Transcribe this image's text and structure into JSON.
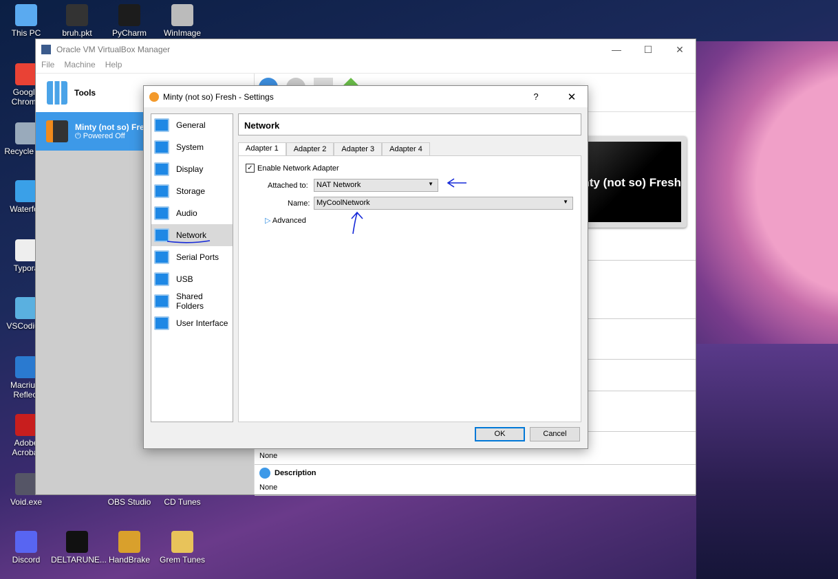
{
  "desktop": {
    "icons": [
      "This PC",
      "bruh.pkt",
      "PyCharm",
      "WinImage",
      "Google Chrome",
      "Recycle Bin",
      "Waterfox",
      "Typora",
      "VSCodium",
      "Macrium Reflect",
      "Adobe Acrobat",
      "Void.exe",
      "OBS Studio",
      "CD Tunes",
      "Discord",
      "DELTARUNE...",
      "HandBrake",
      "Grem Tunes"
    ]
  },
  "manager": {
    "title": "Oracle VM VirtualBox Manager",
    "menu": [
      "File",
      "Machine",
      "Help"
    ],
    "tools_label": "Tools",
    "vm_name": "Minty (not so) Fresh",
    "vm_state": "Powered Off",
    "preview_text": "Minty (not so) Fresh",
    "details": {
      "none1": "None",
      "description_title": "Description",
      "none2": "None"
    }
  },
  "dialog": {
    "title": "Minty (not so) Fresh - Settings",
    "help": "?",
    "close": "✕",
    "sidebar": [
      {
        "label": "General"
      },
      {
        "label": "System"
      },
      {
        "label": "Display"
      },
      {
        "label": "Storage"
      },
      {
        "label": "Audio"
      },
      {
        "label": "Network",
        "selected": true
      },
      {
        "label": "Serial Ports"
      },
      {
        "label": "USB"
      },
      {
        "label": "Shared Folders"
      },
      {
        "label": "User Interface"
      }
    ],
    "section_title": "Network",
    "tabs": [
      "Adapter 1",
      "Adapter 2",
      "Adapter 3",
      "Adapter 4"
    ],
    "active_tab": "Adapter 1",
    "enable_label": "Enable Network Adapter",
    "enable_checked": true,
    "attached_label": "Attached to:",
    "attached_value": "NAT Network",
    "name_label": "Name:",
    "name_value": "MyCoolNetwork",
    "advanced_label": "Advanced",
    "ok": "OK",
    "cancel": "Cancel"
  },
  "colors": {
    "selection": "#3d99e8",
    "accent": "#0078d7",
    "annotation": "#1428d8"
  }
}
